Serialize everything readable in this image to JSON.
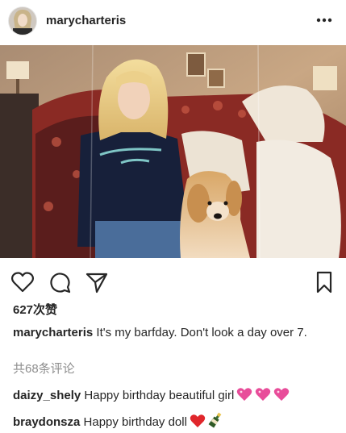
{
  "post": {
    "username": "marycharteris",
    "likes_text": "627次赞",
    "caption": {
      "username": "marycharteris",
      "text": "It's my barfday. Don't look a day over 7."
    },
    "view_comments_text": "共68条评论",
    "comments": [
      {
        "username": "daizy_shely",
        "text": "Happy birthday beautiful girl",
        "emojis": [
          "sparkling-heart-icon",
          "sparkling-heart-icon",
          "sparkling-heart-icon"
        ]
      },
      {
        "username": "braydonsza",
        "text": "Happy birthday doll",
        "emojis": [
          "red-heart-icon",
          "champagne-bottle-icon"
        ]
      }
    ]
  },
  "icons": {
    "more": "more-options-icon",
    "like": "heart-outline-icon",
    "comment": "comment-bubble-icon",
    "share": "paper-plane-icon",
    "save": "bookmark-icon"
  },
  "colors": {
    "text": "#262626",
    "secondary_text": "#8e8e8e",
    "heart_pink": "#e84d9a",
    "heart_red": "#e0262b"
  }
}
